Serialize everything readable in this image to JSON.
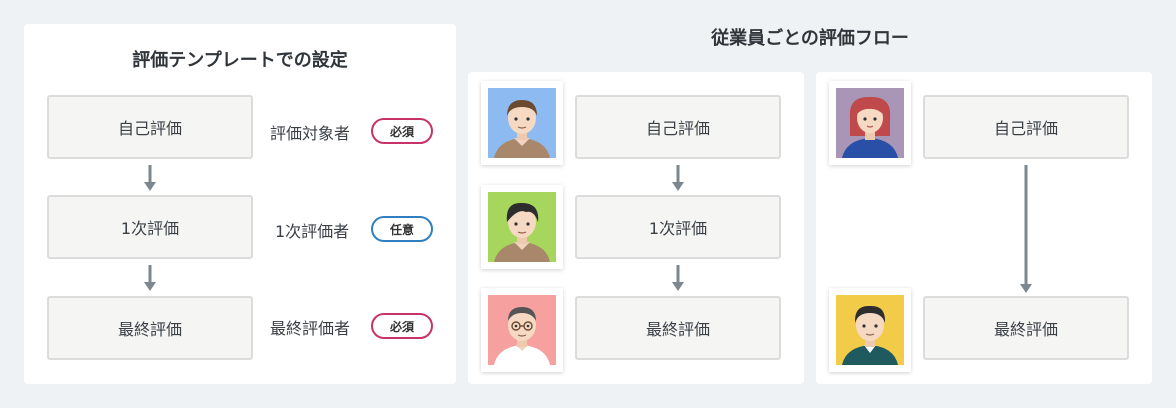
{
  "template": {
    "title": "評価テンプレートでの設定",
    "steps": [
      "自己評価",
      "1次評価",
      "最終評価"
    ],
    "roles": [
      {
        "label": "評価対象者",
        "badge": "必須",
        "type": "required"
      },
      {
        "label": "1次評価者",
        "badge": "任意",
        "type": "optional"
      },
      {
        "label": "最終評価者",
        "badge": "必須",
        "type": "required"
      }
    ]
  },
  "employee_flow": {
    "title": "従業員ごとの評価フロー",
    "flow_a": {
      "steps": [
        "自己評価",
        "1次評価",
        "最終評価"
      ],
      "avatars": [
        "person-brown-hair-blue-bg",
        "person-black-hair-green-bg",
        "person-glasses-pink-bg"
      ]
    },
    "flow_b": {
      "steps": [
        "自己評価",
        "最終評価"
      ],
      "avatars": [
        "person-red-hair-purple-bg",
        "person-dark-hair-yellow-bg"
      ]
    }
  },
  "colors": {
    "background": "#eff2f5",
    "required_badge": "#c73368",
    "optional_badge": "#2f7fc1",
    "arrow": "#7d8790"
  }
}
